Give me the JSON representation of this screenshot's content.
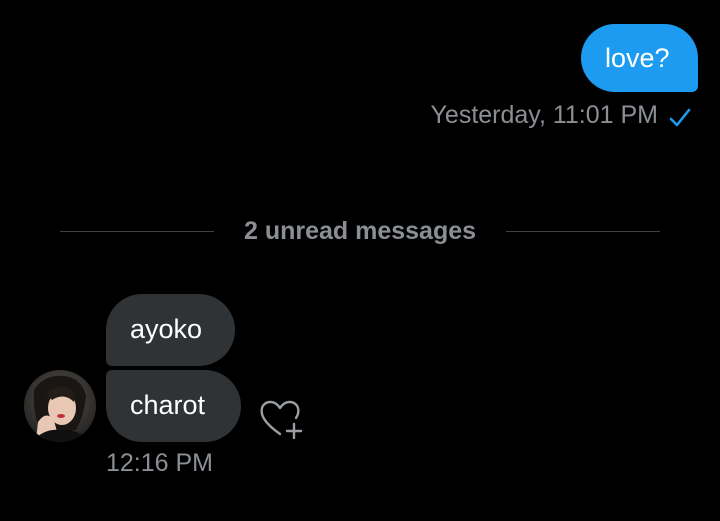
{
  "conversation": {
    "sent": {
      "message": "love?",
      "timestamp": "Yesterday, 11:01 PM",
      "status_icon": "read-check-icon"
    },
    "divider": {
      "label": "2 unread messages"
    },
    "received": {
      "messages": [
        {
          "text": "ayoko"
        },
        {
          "text": "charot"
        }
      ],
      "timestamp": "12:16 PM",
      "avatar_icon": "avatar-photo",
      "reaction_icon": "heart-plus-icon"
    }
  },
  "colors": {
    "background": "#000000",
    "sent_bubble": "#1d9bf0",
    "received_bubble": "#2f3336",
    "muted_text": "#8b8f94"
  }
}
